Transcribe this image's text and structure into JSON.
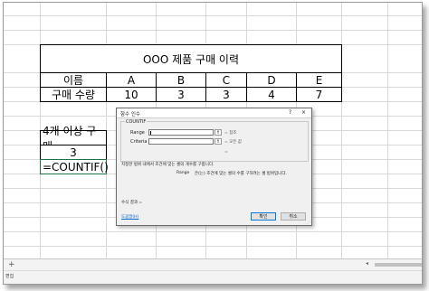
{
  "sheet": {
    "title": "OOO 제품 구매 이력",
    "header_label": "이름",
    "names": [
      "A",
      "B",
      "C",
      "D",
      "E"
    ],
    "qty_label": "구매 수량",
    "quantities": [
      "10",
      "3",
      "3",
      "4",
      "7"
    ],
    "condition_label": "4개 이상 구매",
    "count_result": "3",
    "formula_cell": "=COUNTIF()"
  },
  "dialog": {
    "title": "함수 인수",
    "help_glyph": "?",
    "close_glyph": "×",
    "function_name": "COUNTIF",
    "range_label": "Range",
    "criteria_label": "Criteria",
    "ref_glyph": "⇑",
    "range_hint": "= 참조",
    "criteria_hint": "= 모든 값",
    "equals": "=",
    "description": "지정한 범위 내에서 조건에 맞는 셀의 개수를 구합니다.",
    "arg_help_name": "Range",
    "arg_help_text": "은(는) 조건에 맞는 셀의 수를 구하려는 셀 범위입니다.",
    "result_label": "수식 결과 =",
    "help_link": "도움말(H)",
    "ok_label": "확인",
    "cancel_label": "취소"
  },
  "bottom": {
    "add_sheet": "+",
    "status": "편집"
  }
}
